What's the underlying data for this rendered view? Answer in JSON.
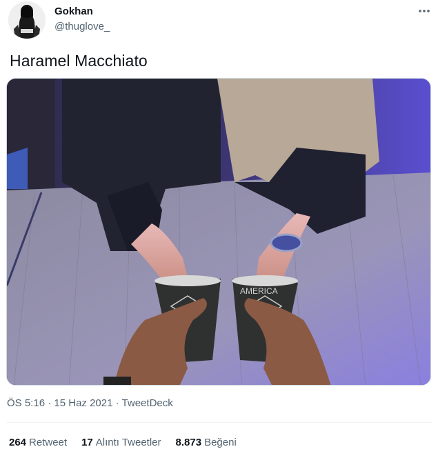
{
  "user": {
    "name": "Gokhan",
    "handle": "@thuglove_",
    "avatar_icon": "hooded-figure-avatar"
  },
  "more_icon": "more-dots-icon",
  "tweet": {
    "text": "Haramel Macchiato",
    "media_description_icon": "photo-two-coffee-cups"
  },
  "meta": {
    "time": "ÖS 5:16",
    "separator": "·",
    "date": "15 Haz 2021",
    "source": "TweetDeck"
  },
  "stats": {
    "retweets_count": "264",
    "retweets_label": "Retweet",
    "quotes_count": "17",
    "quotes_label": "Alıntı Tweetler",
    "likes_count": "8.873",
    "likes_label": "Beğeni"
  },
  "colors": {
    "text_primary": "#0f1419",
    "text_secondary": "#536471",
    "divider": "#eff3f4"
  }
}
